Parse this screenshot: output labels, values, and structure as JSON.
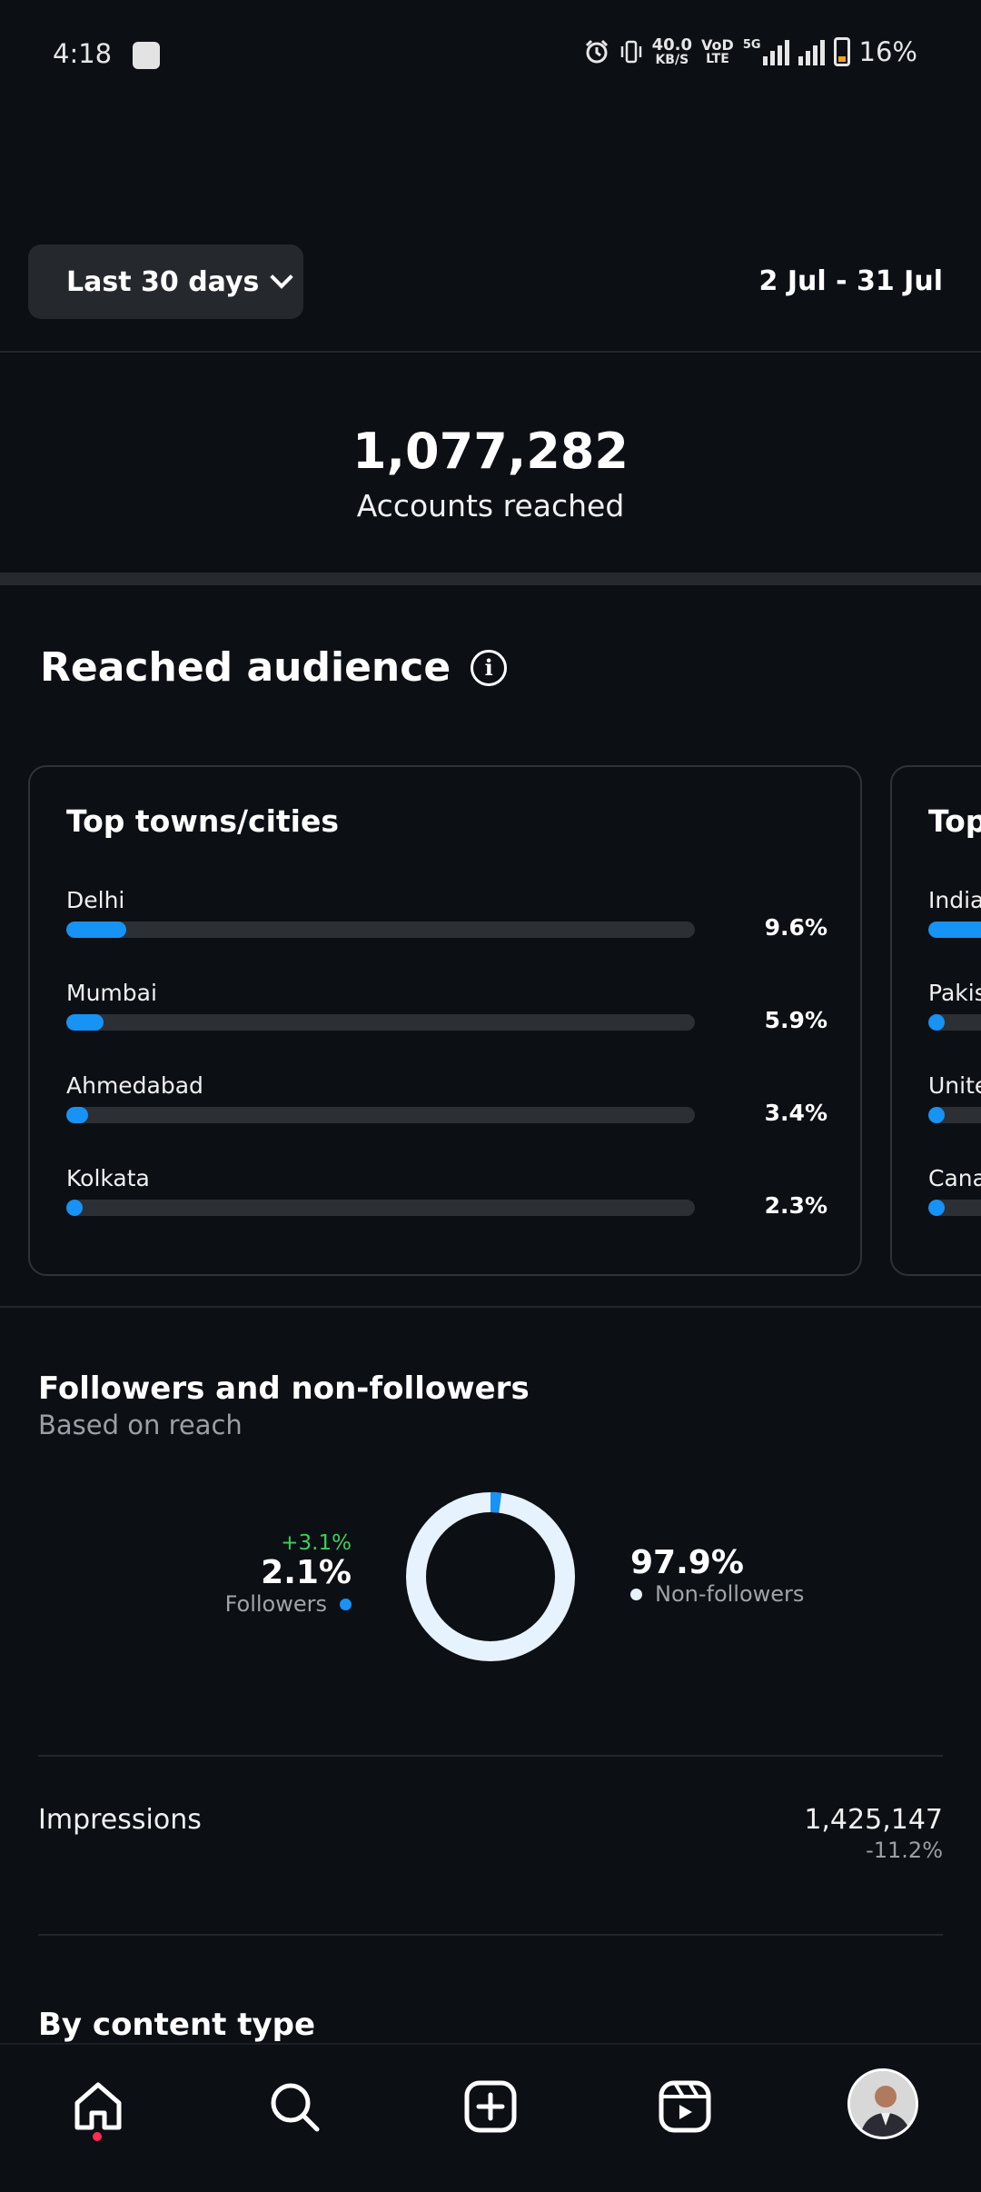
{
  "status_bar": {
    "time": "4:18",
    "net_speed_top": "40.0",
    "net_speed_bottom": "KB/S",
    "volte_top": "VoD",
    "volte_bottom": "LTE",
    "network": "5G",
    "battery": "16%"
  },
  "range": {
    "selector_label": "Last 30 days",
    "dates": "2 Jul - 31 Jul"
  },
  "summary": {
    "accounts_value": "1,077,282",
    "accounts_label": "Accounts reached"
  },
  "reached_audience": {
    "title": "Reached audience",
    "info_glyph": "i",
    "cards": [
      {
        "title": "Top towns/cities",
        "rows": [
          {
            "name": "Delhi",
            "value": "9.6%",
            "fraction": 0.096
          },
          {
            "name": "Mumbai",
            "value": "5.9%",
            "fraction": 0.059
          },
          {
            "name": "Ahmedabad",
            "value": "3.4%",
            "fraction": 0.034
          },
          {
            "name": "Kolkata",
            "value": "2.3%",
            "fraction": 0.023
          }
        ]
      },
      {
        "title": "Top",
        "rows": [
          {
            "name": "India",
            "fraction": 0.85
          },
          {
            "name": "Pakis",
            "fraction": 0.02
          },
          {
            "name": "Unite",
            "fraction": 0.01
          },
          {
            "name": "Cana",
            "fraction": 0.01
          }
        ]
      }
    ]
  },
  "followers": {
    "title": "Followers and non-followers",
    "subtitle": "Based on reach",
    "followers_change": "+3.1%",
    "followers_percent": "2.1%",
    "followers_label": "Followers",
    "followers_fraction": 0.021,
    "non_followers_percent": "97.9%",
    "non_followers_label": "Non-followers",
    "colors": {
      "followers": "#1792f5",
      "non_followers": "#e6f2fd"
    }
  },
  "impressions": {
    "label": "Impressions",
    "value": "1,425,147",
    "change": "-11.2%"
  },
  "content_type": {
    "title": "By content type"
  },
  "nav": {
    "items": [
      "home-icon",
      "search-icon",
      "create-icon",
      "reels-icon",
      "profile-avatar"
    ]
  }
}
